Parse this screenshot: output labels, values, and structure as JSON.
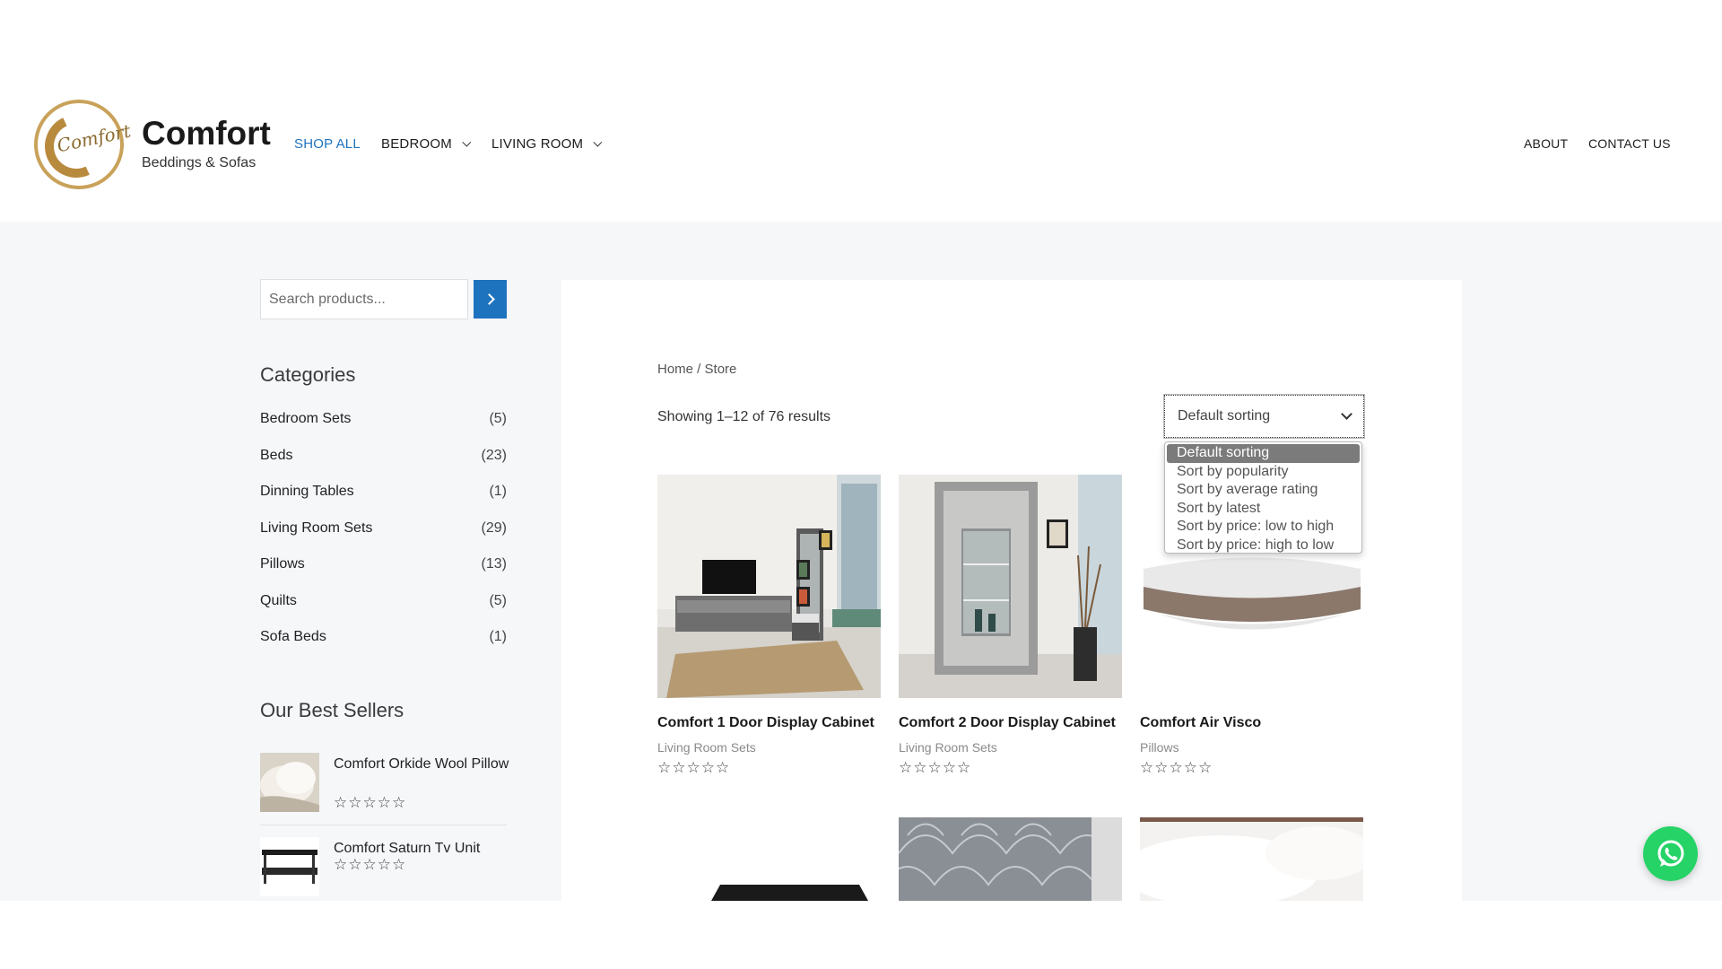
{
  "brand": {
    "name": "Comfort",
    "tagline": "Beddings & Sofas",
    "logo_script": "Comfort"
  },
  "nav": {
    "left": [
      {
        "label": "SHOP ALL",
        "active": true,
        "dropdown": false
      },
      {
        "label": "BEDROOM",
        "active": false,
        "dropdown": true
      },
      {
        "label": "LIVING ROOM",
        "active": false,
        "dropdown": true
      }
    ],
    "right": [
      {
        "label": "ABOUT"
      },
      {
        "label": "CONTACT US"
      }
    ]
  },
  "sidebar": {
    "search": {
      "placeholder": "Search products...",
      "button_icon": "chevron-right-icon"
    },
    "categories_title": "Categories",
    "categories": [
      {
        "label": "Bedroom Sets",
        "count": "(5)"
      },
      {
        "label": "Beds",
        "count": "(23)"
      },
      {
        "label": "Dinning Tables",
        "count": "(1)"
      },
      {
        "label": "Living Room Sets",
        "count": "(29)"
      },
      {
        "label": "Pillows",
        "count": "(13)"
      },
      {
        "label": "Quilts",
        "count": "(5)"
      },
      {
        "label": "Sofa Beds",
        "count": "(1)"
      }
    ],
    "best_sellers_title": "Our Best Sellers",
    "best_sellers": [
      {
        "name": "Comfort Orkide Wool Pillow",
        "stars": "☆☆☆☆☆"
      },
      {
        "name": "Comfort Saturn Tv Unit",
        "stars": "☆☆☆☆☆"
      }
    ]
  },
  "main": {
    "breadcrumb": {
      "home": "Home",
      "sep": " / ",
      "current": "Store"
    },
    "result_count": "Showing 1–12 of 76 results",
    "sort": {
      "selected": "Default sorting",
      "options": [
        "Default sorting",
        "Sort by popularity",
        "Sort by average rating",
        "Sort by latest",
        "Sort by price: low to high",
        "Sort by price: high to low"
      ]
    },
    "products": [
      {
        "title": "Comfort 1 Door Display Cabinet",
        "category": "Living Room Sets",
        "stars": "☆☆☆☆☆"
      },
      {
        "title": "Comfort 2 Door Display Cabinet",
        "category": "Living Room Sets",
        "stars": "☆☆☆☆☆"
      },
      {
        "title": "Comfort Air Visco",
        "category": "Pillows",
        "stars": "☆☆☆☆☆"
      }
    ]
  },
  "colors": {
    "accent": "#1e73be",
    "whatsapp": "#25d366",
    "page_bg": "#f5f7f9",
    "logo_gold": "#b88a3e"
  },
  "widgets": {
    "chat_icon": "whatsapp-icon"
  }
}
